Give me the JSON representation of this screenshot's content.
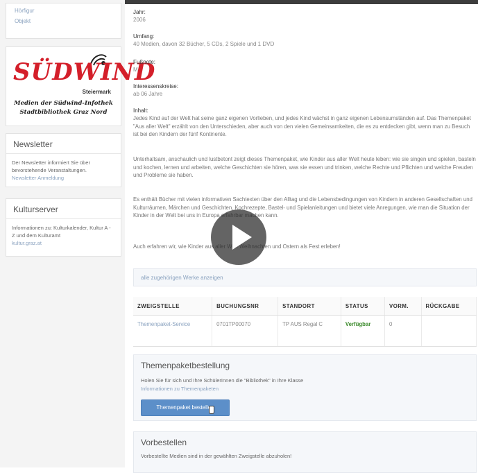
{
  "sidebar": {
    "nav": [
      "Hörfigur",
      "Objekt"
    ],
    "logo": {
      "brand": "SÜDWIND",
      "region": "Steiermark",
      "line1": "Medien der Südwind-Infothek",
      "line2": "Stadtbibliothek Graz Nord"
    },
    "newsletter": {
      "title": "Newsletter",
      "text": "Der Newsletter informiert Sie über bevorstehende Veranstaltungen.",
      "link": "Newsletter Anmeldung"
    },
    "kulturserver": {
      "title": "Kulturserver",
      "text": "Informationen zu: Kulturkalender, Kultur A - Z und dem Kulturamt",
      "link": "kultur.graz.at"
    }
  },
  "details": {
    "jahr_label": "Jahr:",
    "jahr_value": "2006",
    "umfang_label": "Umfang:",
    "umfang_value": "40 Medien, davon 32 Bücher, 5 CDs, 2 Spiele und 1 DVD",
    "fussnote_label": "Fußnote:",
    "fussnote_value": "M",
    "interessen_label": "Interessenskreise:",
    "interessen_value": "ab 06 Jahre",
    "inhalt_label": "Inhalt:",
    "inhalt_p1": "Jedes Kind auf der Welt hat seine ganz eigenen Vorlieben, und jedes Kind wächst in ganz eigenen Lebensumständen auf. Das Themenpaket \"Aus aller Welt\" erzählt von den Unterschieden, aber auch von den vielen Gemeinsamkeiten, die es zu entdecken gibt, wenn man zu Besuch ist bei den Kindern der fünf Kontinente.",
    "inhalt_p2": "Unterhaltsam, anschaulich und lustbetont zeigt dieses Themenpaket, wie Kinder aus aller Welt heute leben: wie sie singen und spielen, basteln und kochen, lernen und arbeiten, welche Geschichten sie hören, was sie essen und trinken, welche Rechte und Pflichten und welche Freuden und Probleme sie haben.",
    "inhalt_p3": "Es enthält Bücher mit vielen informativen Sachtexten über den Alltag und die Lebensbedingungen von Kindern in anderen Gesellschaften und Kulturräumen, Märchen und Geschichten, Kochrezepte, Bastel- und Spielanleitungen und bietet viele Anregungen, wie man die Situation der Kinder in der Welt bei uns in Europa erfahrbar machen kann.",
    "inhalt_p4": "Auch erfahren wir, wie Kinder aus aller Welt Weihnachten und Ostern als Fest erleben!"
  },
  "works_link": "alle zugehörigen Werke anzeigen",
  "holdings": {
    "headers": [
      "ZWEIGSTELLE",
      "BUCHUNGSNR",
      "STANDORT",
      "STATUS",
      "VORM.",
      "RÜCKGABE"
    ],
    "rows": [
      {
        "zweigstelle": "Themenpaket-Service",
        "buchungsnr": "0701TP00070",
        "standort": "TP AUS Regal C",
        "status": "Verfügbar",
        "vorm": "0",
        "rueckgabe": ""
      }
    ]
  },
  "order": {
    "title": "Themenpaketbestellung",
    "text": "Holen Sie für sich und Ihre SchülerInnen die \"Bibliothek\" in Ihre Klasse",
    "link": "Informationen zu Themenpaketen",
    "button": "Themenpaket bestellen"
  },
  "preorder": {
    "title": "Vorbestellen",
    "text": "Vorbestellte Medien sind in der gewählten Zweigstelle abzuholen!"
  },
  "colors": {
    "brand_red": "#d41f2a",
    "button_blue": "#5c8fc9",
    "status_green": "#3a8a2a",
    "link": "#8aa2bf"
  },
  "overlay": {
    "icon": "play-icon"
  }
}
